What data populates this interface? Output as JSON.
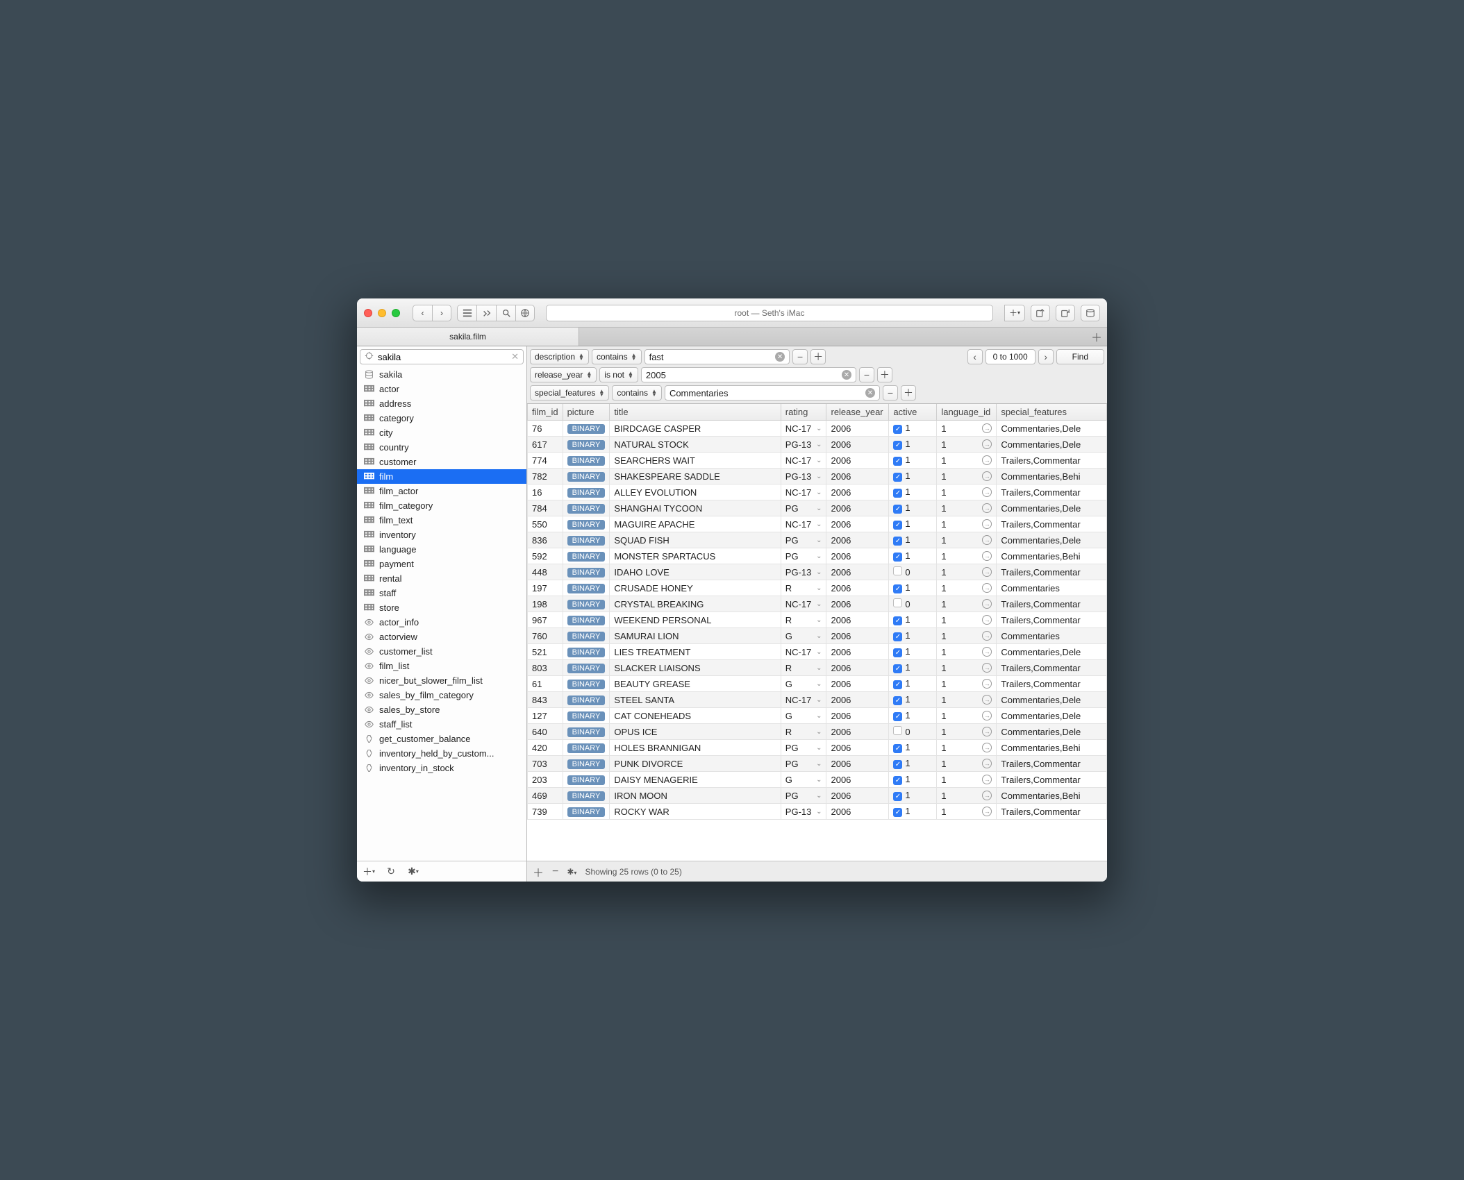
{
  "address": "root — Seth's iMac",
  "tabs": {
    "active": "sakila.film"
  },
  "sidebar": {
    "search_value": "sakila",
    "items": [
      {
        "icon": "db",
        "label": "sakila"
      },
      {
        "icon": "table",
        "label": "actor"
      },
      {
        "icon": "table",
        "label": "address"
      },
      {
        "icon": "table",
        "label": "category"
      },
      {
        "icon": "table",
        "label": "city"
      },
      {
        "icon": "table",
        "label": "country"
      },
      {
        "icon": "table",
        "label": "customer"
      },
      {
        "icon": "table",
        "label": "film",
        "selected": true
      },
      {
        "icon": "table",
        "label": "film_actor"
      },
      {
        "icon": "table",
        "label": "film_category"
      },
      {
        "icon": "table",
        "label": "film_text"
      },
      {
        "icon": "table",
        "label": "inventory"
      },
      {
        "icon": "table",
        "label": "language"
      },
      {
        "icon": "table",
        "label": "payment"
      },
      {
        "icon": "table",
        "label": "rental"
      },
      {
        "icon": "table",
        "label": "staff"
      },
      {
        "icon": "table",
        "label": "store"
      },
      {
        "icon": "view",
        "label": "actor_info"
      },
      {
        "icon": "view",
        "label": "actorview"
      },
      {
        "icon": "view",
        "label": "customer_list"
      },
      {
        "icon": "view",
        "label": "film_list"
      },
      {
        "icon": "view",
        "label": "nicer_but_slower_film_list"
      },
      {
        "icon": "view",
        "label": "sales_by_film_category"
      },
      {
        "icon": "view",
        "label": "sales_by_store"
      },
      {
        "icon": "view",
        "label": "staff_list"
      },
      {
        "icon": "proc",
        "label": "get_customer_balance"
      },
      {
        "icon": "proc",
        "label": "inventory_held_by_custom..."
      },
      {
        "icon": "proc",
        "label": "inventory_in_stock"
      }
    ]
  },
  "filters": [
    {
      "field": "description",
      "op": "contains",
      "value": "fast"
    },
    {
      "field": "release_year",
      "op": "is not",
      "value": "2005"
    },
    {
      "field": "special_features",
      "op": "contains",
      "value": "Commentaries"
    }
  ],
  "pager": {
    "range": "0 to 1000"
  },
  "find_label": "Find",
  "columns": [
    "film_id",
    "picture",
    "title",
    "rating",
    "release_year",
    "active",
    "language_id",
    "special_features"
  ],
  "binary_label": "BINARY",
  "rows": [
    {
      "film_id": "76",
      "title": "BIRDCAGE CASPER",
      "rating": "NC-17",
      "release_year": "2006",
      "active": 1,
      "language_id": "1",
      "special_features": "Commentaries,Dele"
    },
    {
      "film_id": "617",
      "title": "NATURAL STOCK",
      "rating": "PG-13",
      "release_year": "2006",
      "active": 1,
      "language_id": "1",
      "special_features": "Commentaries,Dele"
    },
    {
      "film_id": "774",
      "title": "SEARCHERS WAIT",
      "rating": "NC-17",
      "release_year": "2006",
      "active": 1,
      "language_id": "1",
      "special_features": "Trailers,Commentar"
    },
    {
      "film_id": "782",
      "title": "SHAKESPEARE SADDLE",
      "rating": "PG-13",
      "release_year": "2006",
      "active": 1,
      "language_id": "1",
      "special_features": "Commentaries,Behi"
    },
    {
      "film_id": "16",
      "title": "ALLEY EVOLUTION",
      "rating": "NC-17",
      "release_year": "2006",
      "active": 1,
      "language_id": "1",
      "special_features": "Trailers,Commentar"
    },
    {
      "film_id": "784",
      "title": "SHANGHAI TYCOON",
      "rating": "PG",
      "release_year": "2006",
      "active": 1,
      "language_id": "1",
      "special_features": "Commentaries,Dele"
    },
    {
      "film_id": "550",
      "title": "MAGUIRE APACHE",
      "rating": "NC-17",
      "release_year": "2006",
      "active": 1,
      "language_id": "1",
      "special_features": "Trailers,Commentar"
    },
    {
      "film_id": "836",
      "title": "SQUAD FISH",
      "rating": "PG",
      "release_year": "2006",
      "active": 1,
      "language_id": "1",
      "special_features": "Commentaries,Dele"
    },
    {
      "film_id": "592",
      "title": "MONSTER SPARTACUS",
      "rating": "PG",
      "release_year": "2006",
      "active": 1,
      "language_id": "1",
      "special_features": "Commentaries,Behi"
    },
    {
      "film_id": "448",
      "title": "IDAHO LOVE",
      "rating": "PG-13",
      "release_year": "2006",
      "active": 0,
      "language_id": "1",
      "special_features": "Trailers,Commentar"
    },
    {
      "film_id": "197",
      "title": "CRUSADE HONEY",
      "rating": "R",
      "release_year": "2006",
      "active": 1,
      "language_id": "1",
      "special_features": "Commentaries"
    },
    {
      "film_id": "198",
      "title": "CRYSTAL BREAKING",
      "rating": "NC-17",
      "release_year": "2006",
      "active": 0,
      "language_id": "1",
      "special_features": "Trailers,Commentar"
    },
    {
      "film_id": "967",
      "title": "WEEKEND PERSONAL",
      "rating": "R",
      "release_year": "2006",
      "active": 1,
      "language_id": "1",
      "special_features": "Trailers,Commentar"
    },
    {
      "film_id": "760",
      "title": "SAMURAI LION",
      "rating": "G",
      "release_year": "2006",
      "active": 1,
      "language_id": "1",
      "special_features": "Commentaries"
    },
    {
      "film_id": "521",
      "title": "LIES TREATMENT",
      "rating": "NC-17",
      "release_year": "2006",
      "active": 1,
      "language_id": "1",
      "special_features": "Commentaries,Dele"
    },
    {
      "film_id": "803",
      "title": "SLACKER LIAISONS",
      "rating": "R",
      "release_year": "2006",
      "active": 1,
      "language_id": "1",
      "special_features": "Trailers,Commentar"
    },
    {
      "film_id": "61",
      "title": "BEAUTY GREASE",
      "rating": "G",
      "release_year": "2006",
      "active": 1,
      "language_id": "1",
      "special_features": "Trailers,Commentar"
    },
    {
      "film_id": "843",
      "title": "STEEL SANTA",
      "rating": "NC-17",
      "release_year": "2006",
      "active": 1,
      "language_id": "1",
      "special_features": "Commentaries,Dele"
    },
    {
      "film_id": "127",
      "title": "CAT CONEHEADS",
      "rating": "G",
      "release_year": "2006",
      "active": 1,
      "language_id": "1",
      "special_features": "Commentaries,Dele"
    },
    {
      "film_id": "640",
      "title": "OPUS ICE",
      "rating": "R",
      "release_year": "2006",
      "active": 0,
      "language_id": "1",
      "special_features": "Commentaries,Dele"
    },
    {
      "film_id": "420",
      "title": "HOLES BRANNIGAN",
      "rating": "PG",
      "release_year": "2006",
      "active": 1,
      "language_id": "1",
      "special_features": "Commentaries,Behi"
    },
    {
      "film_id": "703",
      "title": "PUNK DIVORCE",
      "rating": "PG",
      "release_year": "2006",
      "active": 1,
      "language_id": "1",
      "special_features": "Trailers,Commentar"
    },
    {
      "film_id": "203",
      "title": "DAISY MENAGERIE",
      "rating": "G",
      "release_year": "2006",
      "active": 1,
      "language_id": "1",
      "special_features": "Trailers,Commentar"
    },
    {
      "film_id": "469",
      "title": "IRON MOON",
      "rating": "PG",
      "release_year": "2006",
      "active": 1,
      "language_id": "1",
      "special_features": "Commentaries,Behi"
    },
    {
      "film_id": "739",
      "title": "ROCKY WAR",
      "rating": "PG-13",
      "release_year": "2006",
      "active": 1,
      "language_id": "1",
      "special_features": "Trailers,Commentar"
    }
  ],
  "status": "Showing 25 rows (0 to 25)"
}
